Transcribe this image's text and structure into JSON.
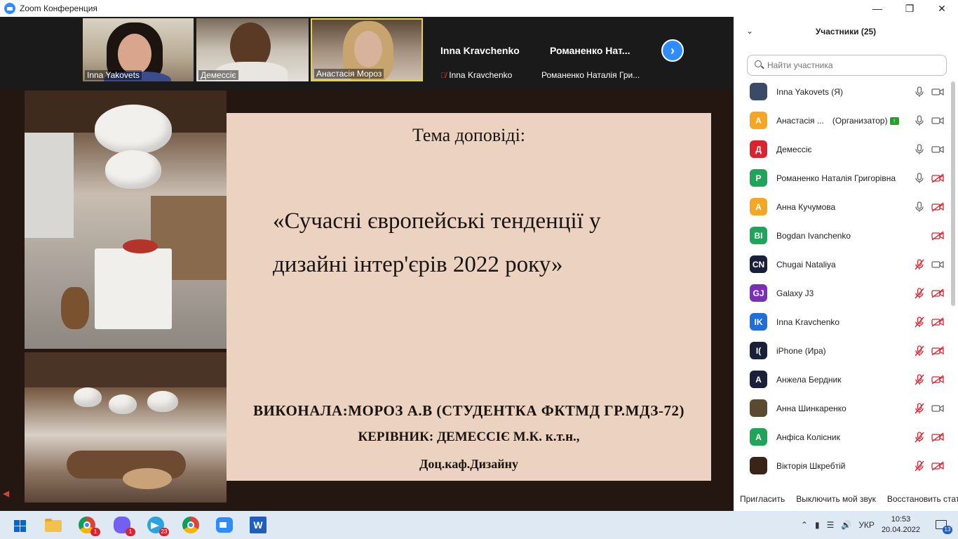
{
  "window": {
    "title": "Zoom Конференция",
    "min_icon": "minimize-icon",
    "max_icon": "maximize-icon",
    "close_icon": "close-icon"
  },
  "video_strip": {
    "tiles": [
      {
        "name": "Inna Yakovets"
      },
      {
        "name": "Демессіє"
      },
      {
        "name": "Анастасія Мороз"
      }
    ],
    "name_tiles": [
      {
        "big": "Inna Kravchenko",
        "small": "Inna Kravchenko",
        "muted": true
      },
      {
        "big": "Романенко  Нат...",
        "small": "Романенко Наталія Гри..."
      }
    ],
    "next_icon": "chevron-right-icon"
  },
  "slide": {
    "topic": "Тема доповіді:",
    "title_line1": "«Сучасні європейські тенденції у",
    "title_line2": "дизайні інтер'єрів 2022 року»",
    "author": "ВИКОНАЛА:МОРОЗ А.В (СТУДЕНТКА ФКТМД ГР.МДЗ-72)",
    "advisor": "КЕРІВНИК: ДЕМЕССІЄ М.К. к.т.н.,",
    "department": "Доц.каф.Дизайну",
    "background_color": "#ebd2c1"
  },
  "participants_panel": {
    "title": "Участники (25)",
    "search_placeholder": "Найти участника",
    "participants": [
      {
        "avatar": "",
        "avatar_color": "#3b4a66",
        "photo": true,
        "name": "Inna Yakovets (Я)",
        "mic": "on",
        "camera": "on"
      },
      {
        "avatar": "А",
        "avatar_color": "#f5a623",
        "name": "Анастасія ...",
        "role": "(Организатор)",
        "sharing": true,
        "mic": "on",
        "camera": "on"
      },
      {
        "avatar": "Д",
        "avatar_color": "#d9232e",
        "name": "Демессіє",
        "mic": "on",
        "camera": "on"
      },
      {
        "avatar": "Р",
        "avatar_color": "#1ea55a",
        "name": "Романенко Наталія Григорівна",
        "mic": "on",
        "camera": "off"
      },
      {
        "avatar": "А",
        "avatar_color": "#f5a623",
        "name": "Анна Кучумова",
        "mic": "on",
        "camera": "off"
      },
      {
        "avatar": "BI",
        "avatar_color": "#1ea55a",
        "name": "Bogdan Ivanchenko",
        "mic": "none",
        "camera": "off-red"
      },
      {
        "avatar": "CN",
        "avatar_color": "#1a1f3a",
        "name": "Chugai Nataliya",
        "mic": "off",
        "camera": "on"
      },
      {
        "avatar": "GJ",
        "avatar_color": "#7b2fb6",
        "name": "Galaxy J3",
        "mic": "off",
        "camera": "off"
      },
      {
        "avatar": "IK",
        "avatar_color": "#1e6fd9",
        "name": "Inna Kravchenko",
        "mic": "off",
        "camera": "off"
      },
      {
        "avatar": "I(",
        "avatar_color": "#1a1f3a",
        "name": "iPhone (Ира)",
        "mic": "off",
        "camera": "off"
      },
      {
        "avatar": "А",
        "avatar_color": "#1a1f3a",
        "name": "Анжела Бердник",
        "mic": "off",
        "camera": "off"
      },
      {
        "avatar": "",
        "avatar_color": "#5a4a30",
        "photo": true,
        "name": "Анна Шинкаренко",
        "mic": "off",
        "camera": "on"
      },
      {
        "avatar": "А",
        "avatar_color": "#1ea55a",
        "name": "Анфіса Колісник",
        "mic": "off",
        "camera": "off"
      },
      {
        "avatar": "",
        "avatar_color": "#3a2418",
        "photo": true,
        "name": "Вікторія Шкребтій",
        "mic": "off",
        "camera": "off"
      }
    ],
    "footer": {
      "invite": "Пригласить",
      "mute_me": "Выключить мой звук",
      "restore": "Восстановить стат"
    }
  },
  "taskbar": {
    "apps": [
      {
        "icon": "windows-start-icon"
      },
      {
        "icon": "file-explorer-icon"
      },
      {
        "icon": "chrome-icon",
        "badge": "1"
      },
      {
        "icon": "viber-icon",
        "badge": "1"
      },
      {
        "icon": "telegram-icon",
        "badge": "23"
      },
      {
        "icon": "chrome-alt-icon"
      },
      {
        "icon": "zoom-icon"
      },
      {
        "icon": "word-icon"
      }
    ],
    "language": "УКР",
    "time": "10:53",
    "date": "20.04.2022",
    "notifications": "13"
  }
}
